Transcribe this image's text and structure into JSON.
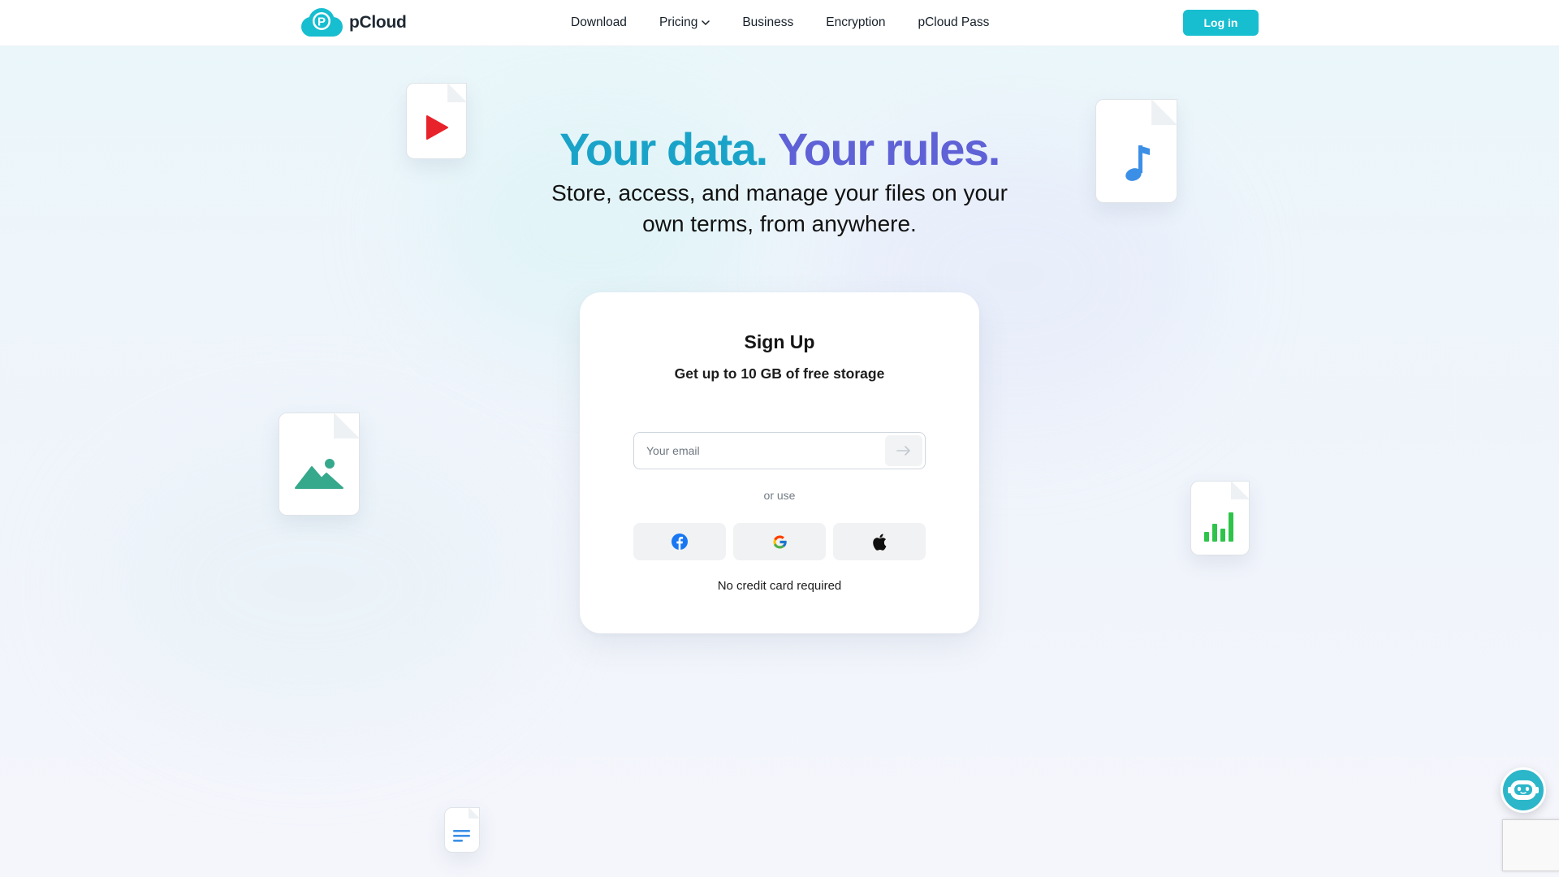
{
  "brand": {
    "name": "pCloud",
    "logo_letter": "P",
    "accent_color": "#17bed0"
  },
  "nav": {
    "items": [
      {
        "label": "Download"
      },
      {
        "label": "Pricing",
        "has_dropdown": true
      },
      {
        "label": "Business"
      },
      {
        "label": "Encryption"
      },
      {
        "label": "pCloud Pass"
      }
    ],
    "login_label": "Log in"
  },
  "hero": {
    "title_part1": "Your data.",
    "title_part2": "Your rules.",
    "subtitle": "Store, access, and manage your files on your own terms, from anywhere."
  },
  "signup": {
    "title": "Sign Up",
    "subtitle": "Get up to 10 GB of free storage",
    "email_placeholder": "Your email",
    "email_value": "",
    "submit_icon": "arrow-right-icon",
    "or_text": "or use",
    "social": [
      {
        "name": "facebook",
        "icon": "facebook-icon"
      },
      {
        "name": "google",
        "icon": "google-icon"
      },
      {
        "name": "apple",
        "icon": "apple-icon"
      }
    ],
    "note": "No credit card required"
  },
  "decor_icons": [
    "video-file-icon",
    "music-file-icon",
    "image-file-icon",
    "chart-file-icon",
    "document-file-icon"
  ],
  "widgets": {
    "chat_icon": "chat-bot-icon",
    "recaptcha": "recaptcha-badge"
  }
}
